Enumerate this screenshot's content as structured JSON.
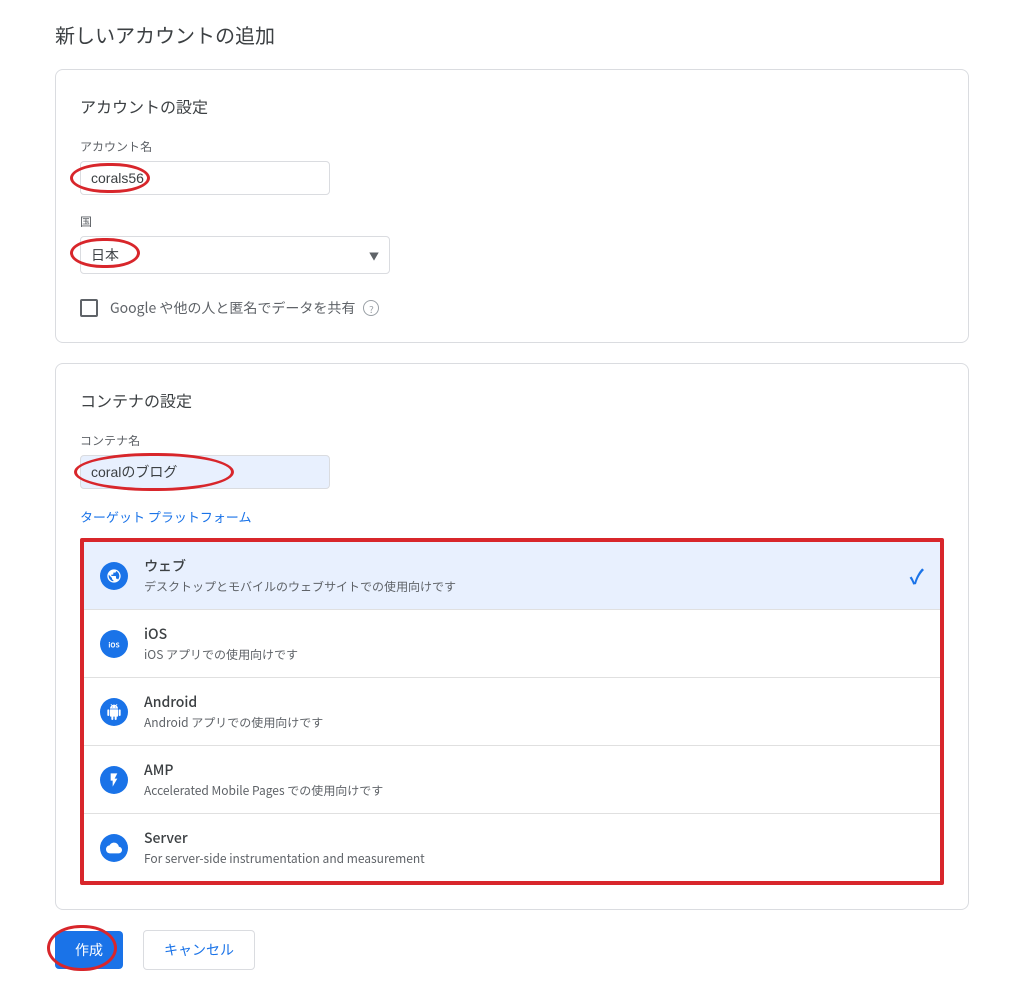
{
  "page": {
    "title": "新しいアカウントの追加"
  },
  "account": {
    "card_title": "アカウントの設定",
    "name_label": "アカウント名",
    "name_value": "corals56",
    "country_label": "国",
    "country_value": "日本",
    "share_label": "Google や他の人と匿名でデータを共有"
  },
  "container": {
    "card_title": "コンテナの設定",
    "name_label": "コンテナ名",
    "name_value": "coralのブログ",
    "target_label": "ターゲット プラットフォーム",
    "platforms": [
      {
        "name": "ウェブ",
        "desc": "デスクトップとモバイルのウェブサイトでの使用向けです",
        "icon": "globe",
        "selected": true
      },
      {
        "name": "iOS",
        "desc": "iOS アプリでの使用向けです",
        "icon": "ios",
        "selected": false
      },
      {
        "name": "Android",
        "desc": "Android アプリでの使用向けです",
        "icon": "android",
        "selected": false
      },
      {
        "name": "AMP",
        "desc": "Accelerated Mobile Pages での使用向けです",
        "icon": "amp",
        "selected": false
      },
      {
        "name": "Server",
        "desc": "For server-side instrumentation and measurement",
        "icon": "server",
        "selected": false
      }
    ]
  },
  "buttons": {
    "create": "作成",
    "cancel": "キャンセル"
  },
  "colors": {
    "accent": "#1a73e8",
    "highlight": "#d8262b",
    "border": "#dadce0",
    "text": "#3c4043",
    "muted": "#5f6368"
  }
}
